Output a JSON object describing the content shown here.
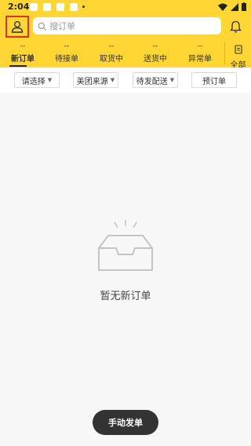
{
  "status_bar": {
    "time": "2:04"
  },
  "header": {
    "search_placeholder": "搜订单"
  },
  "tabs": [
    {
      "count": "--",
      "label": "新订单"
    },
    {
      "count": "--",
      "label": "待接单"
    },
    {
      "count": "--",
      "label": "取货中"
    },
    {
      "count": "--",
      "label": "送货中"
    },
    {
      "count": "--",
      "label": "异常单"
    }
  ],
  "tab_all_label": "全部",
  "filters": [
    {
      "label": "请选择",
      "dropdown": true
    },
    {
      "label": "美团来源",
      "dropdown": true
    },
    {
      "label": "待发配送",
      "dropdown": true
    },
    {
      "label": "预订单",
      "dropdown": false
    }
  ],
  "empty_state": {
    "message": "暂无新订单"
  },
  "fab": {
    "label": "手动发单"
  },
  "colors": {
    "accent": "#ffd633",
    "fab": "#333333",
    "highlight_border": "#e23030"
  }
}
